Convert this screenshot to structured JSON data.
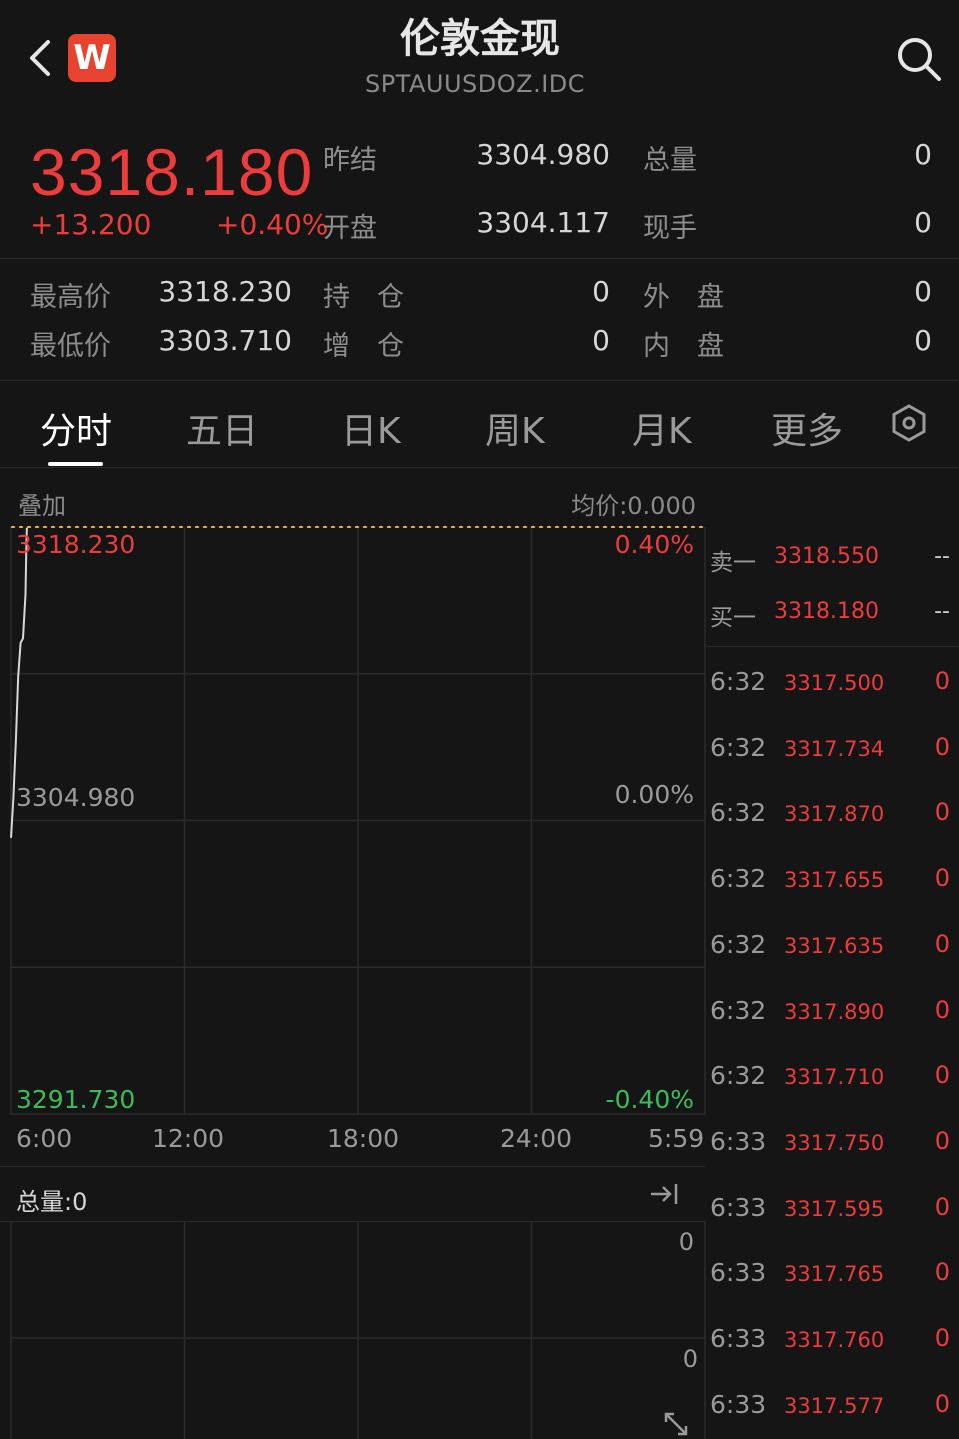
{
  "header": {
    "title": "伦敦金现",
    "subtitle": "SPTAUUSDOZ.IDC",
    "logo_letter": "W",
    "back_icon": "chevron-left-icon",
    "search_icon": "search-icon"
  },
  "quote": {
    "price": "3318.180",
    "change": "+13.200",
    "change_pct": "+0.40%",
    "fields": {
      "prev_settle_label": "昨结",
      "prev_settle": "3304.980",
      "total_vol_label": "总量",
      "total_vol": "0",
      "open_label": "开盘",
      "open": "3304.117",
      "current_hand_label": "现手",
      "current_hand": "0",
      "high_label": "最高价",
      "high": "3318.230",
      "hold_label": "持　仓",
      "hold": "0",
      "outer_label": "外　盘",
      "outer": "0",
      "low_label": "最低价",
      "low": "3303.710",
      "incr_label": "增　仓",
      "incr": "0",
      "inner_label": "内　盘",
      "inner": "0"
    }
  },
  "tabs": [
    "分时",
    "五日",
    "日K",
    "周K",
    "月K",
    "更多"
  ],
  "chart": {
    "overlay_label": "叠加",
    "avg_label": "均价:0.000",
    "top_price": "3318.230",
    "mid_price": "3304.980",
    "bottom_price": "3291.730",
    "top_pct": "0.40%",
    "mid_pct": "0.00%",
    "bottom_pct": "-0.40%",
    "x_labels": [
      "6:00",
      "12:00",
      "18:00",
      "24:00",
      "5:59"
    ],
    "volume_label": "总量:0",
    "volume_top": "0",
    "volume_mid": "0"
  },
  "chart_data": {
    "type": "line",
    "ylim": [
      3291.73,
      3318.23
    ],
    "reference": 3304.98,
    "x": [
      "6:00",
      "6:05",
      "6:10",
      "6:15",
      "6:20",
      "6:25",
      "6:30",
      "6:32",
      "6:33"
    ],
    "series": [
      {
        "values": [
          3304.2,
          3306.0,
          3308.5,
          3311.5,
          3313.0,
          3313.2,
          3315.2,
          3317.5,
          3318.2
        ]
      }
    ],
    "grid": true
  },
  "order_book": {
    "sell_label": "卖一",
    "sell_price": "3318.550",
    "sell_vol": "--",
    "buy_label": "买一",
    "buy_price": "3318.180",
    "buy_vol": "--"
  },
  "ticks": [
    {
      "time": "6:32",
      "price": "3317.500",
      "vol": "0"
    },
    {
      "time": "6:32",
      "price": "3317.734",
      "vol": "0"
    },
    {
      "time": "6:32",
      "price": "3317.870",
      "vol": "0"
    },
    {
      "time": "6:32",
      "price": "3317.655",
      "vol": "0"
    },
    {
      "time": "6:32",
      "price": "3317.635",
      "vol": "0"
    },
    {
      "time": "6:32",
      "price": "3317.890",
      "vol": "0"
    },
    {
      "time": "6:32",
      "price": "3317.710",
      "vol": "0"
    },
    {
      "time": "6:33",
      "price": "3317.750",
      "vol": "0"
    },
    {
      "time": "6:33",
      "price": "3317.595",
      "vol": "0"
    },
    {
      "time": "6:33",
      "price": "3317.765",
      "vol": "0"
    },
    {
      "time": "6:33",
      "price": "3317.760",
      "vol": "0"
    },
    {
      "time": "6:33",
      "price": "3317.577",
      "vol": "0"
    }
  ],
  "colors": {
    "up": "#ec3c3c",
    "down": "#3dbb5a",
    "line": "#d8d8d8",
    "avg_line": "#e3a53a"
  }
}
